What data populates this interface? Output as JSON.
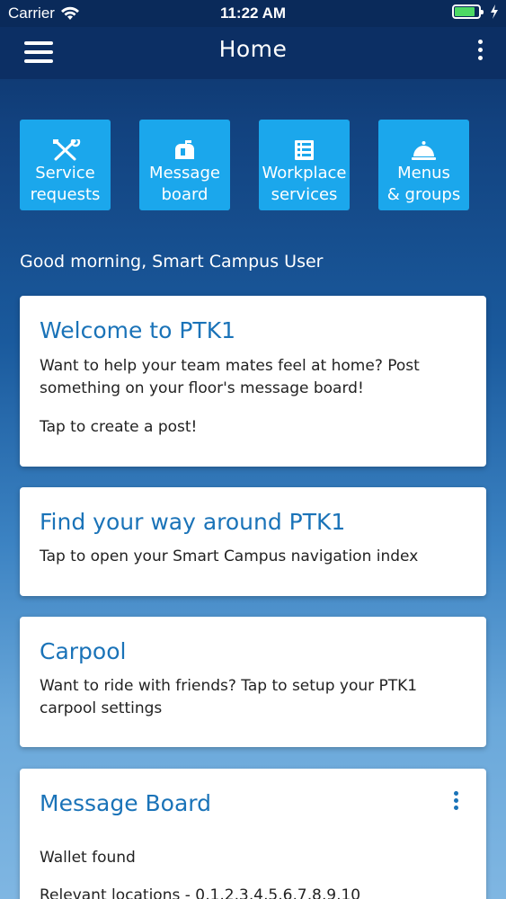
{
  "status_bar": {
    "carrier": "Carrier",
    "time": "11:22 AM",
    "battery_level_percent": 85,
    "battery_color": "#4cd964"
  },
  "nav": {
    "title": "Home",
    "menu_icon": "hamburger-menu-icon",
    "more_icon": "more-vertical-icon"
  },
  "tiles": [
    {
      "label_line1": "Service",
      "label_line2": "requests",
      "icon": "tools-icon"
    },
    {
      "label_line1": "Message",
      "label_line2": "board",
      "icon": "mailbox-icon"
    },
    {
      "label_line1": "Workplace",
      "label_line2": "services",
      "icon": "list-icon"
    },
    {
      "label_line1": "Menus",
      "label_line2": "& groups",
      "icon": "cloche-icon"
    }
  ],
  "greeting": "Good morning, Smart Campus User",
  "cards": [
    {
      "title": "Welcome to PTK1",
      "body": "Want to help your team mates feel at home? Post something on your floor's message board!",
      "footer": "Tap to create a post!"
    },
    {
      "title": "Find your way around PTK1",
      "body": "Tap to open your Smart Campus navigation index"
    },
    {
      "title": "Carpool",
      "body": "Want to ride with friends? Tap to setup your PTK1 carpool settings"
    },
    {
      "title": "Message Board",
      "item": "Wallet found",
      "locations": "Relevant locations - 0,1,2,3,4,5,6,7,8,9,10"
    }
  ],
  "colors": {
    "tile": "#1ba7ec",
    "accent": "#1a73b8",
    "nav": "#0c2f64"
  }
}
